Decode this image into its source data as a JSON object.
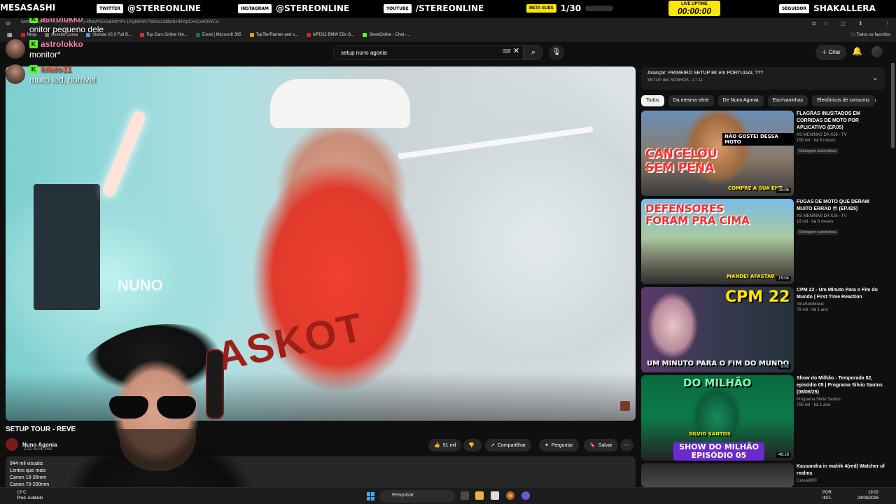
{
  "overlay": {
    "left_text": "MESASASHI",
    "twitter_label": "TWITTER",
    "twitter_handle": "@STEREONLINE",
    "instagram_label": "INSTAGRAM",
    "instagram_handle": "@STEREONLINE",
    "youtube_label": "YOUTUBE",
    "youtube_handle": "/STEREONLINE",
    "meta_label": "META SUBS",
    "meta_value": "1/30",
    "live_label": "LIVE UPTIME",
    "live_time": "00:00:00",
    "follower_label": "SEGUIDOR",
    "follower_name": "SHAKALLERA",
    "accent": "#ffe600"
  },
  "chat": [
    {
      "user": "astrolokko",
      "text": "onitor pequeno dele",
      "color": "#ff7fb6"
    },
    {
      "user": "astrolokko",
      "text": "monitor*",
      "color": "#ff7fb6"
    },
    {
      "user": "kilato11",
      "text": "muito led, horrivel",
      "color": "#ff4d2e"
    }
  ],
  "browser": {
    "url": "www.youtube.com/watch?v=u-lfrevPGIA&list=PL1FgiW5NTb60cLbdb4UIRKpCHCxeOWCo",
    "bookmarks": [
      {
        "label": "Ninja",
        "color": "#c23"
      },
      {
        "label": "Assetto Corsa",
        "color": "#777"
      },
      {
        "label": "Stellata V2.0 Full B...",
        "color": "#59c"
      },
      {
        "label": "Top Cars Online Hor...",
        "color": "#c33"
      },
      {
        "label": "Excel | Microsoft 365",
        "color": "#1d7044"
      },
      {
        "label": "TopTierRamen and s...",
        "color": "#f90"
      },
      {
        "label": "MFD32 BMW E8x G...",
        "color": "#c22"
      },
      {
        "label": "StereOnline - Chat -...",
        "color": "#53fc18"
      }
    ],
    "all_bookmarks": "Todos os favoritos"
  },
  "youtube": {
    "search_value": "setup nuno agonia",
    "create_label": "Criar"
  },
  "video": {
    "overlay_brand": "NUNO",
    "hoodie_text": "ASKOT",
    "title": "SETUP TOUR - REVE",
    "channel": "Nuno Agonia",
    "subs": "2,32 mi de insc",
    "likes": "51 mil",
    "share": "Compartilhar",
    "ask": "Perguntar",
    "save": "Salvar",
    "description": [
      "844 mil visualiz",
      "Lentes que mais",
      "Canon 16-35mm",
      "Canon 70-200mm"
    ]
  },
  "playlist": {
    "title": "Avançar: PRIMEIRO SETUP 8K em PORTUGAL ???",
    "subtitle": "SETUP dos SONHOS - 1 / 11"
  },
  "chips": [
    "Todos",
    "Da mesma série",
    "De Nuno Agonia",
    "Escrivaninhas",
    "Eletrônicos de consumo"
  ],
  "recommendations": [
    {
      "title": "FLAGRAS INUSITADOS EM CORRIDAS DE MOTO POR APLICATIVO (EP.05)",
      "channel": "AS MENINAS DA XJ6 - TV",
      "meta": "159 mil · há 6 meses",
      "badge": "Dublagem automática",
      "duration": "25:06",
      "thumb_text": "CANCELOU SEM PENA",
      "thumb_sub": "NÃO GOSTEI DESSA MOTO",
      "thumb_foot": "COMPRE A SUA ENT"
    },
    {
      "title": "FUGAS DE MOTO QUE DERAM MUITO ERRAD 😳 (EP.425)",
      "channel": "AS MENINAS DA XJ6 - TV",
      "meta": "19 mil · há 3 meses",
      "badge": "Dublagem automática",
      "duration": "15:04",
      "thumb_text": "DEFENSORES FORAM PRA CIMA",
      "thumb_sub": "",
      "thumb_foot": "MANDEI AFASTAR"
    },
    {
      "title": "CPM 22 - Um Minuto Para o Fim do Mundo | First Time Reaction",
      "channel": "InnaSoloMusic",
      "meta": "76 mil · há 1 ano",
      "badge": "",
      "duration": "9:02",
      "thumb_text": "CPM 22",
      "thumb_sub": "",
      "thumb_foot": "UM MINUTO PARA O FIM DO MUNDO"
    },
    {
      "title": "Show do Milhão - Temporada 02, episódio 05 | Programa Silvio Santos (08/06/25)",
      "channel": "Programa Silvio Santos",
      "meta": "706 mil · há 1 ano",
      "badge": "",
      "duration": "46:19",
      "thumb_text": "SHOW DO MILHÃO EPISÓDIO 05",
      "thumb_sub": "DO MILHÃO",
      "thumb_foot": "SILVIO SANTOS"
    },
    {
      "title": "Kassandra in malrik 4(red) Watcher of realms",
      "channel": "Casual300",
      "meta": "",
      "badge": "",
      "duration": "",
      "thumb_text": "",
      "thumb_sub": "",
      "thumb_foot": ""
    }
  ],
  "taskbar": {
    "temp": "15°C",
    "weather": "Pred. nublado",
    "search": "Pesquisar",
    "lang1": "POR",
    "lang2": "INTL",
    "time": "19:02",
    "date": "24/08/2026"
  }
}
